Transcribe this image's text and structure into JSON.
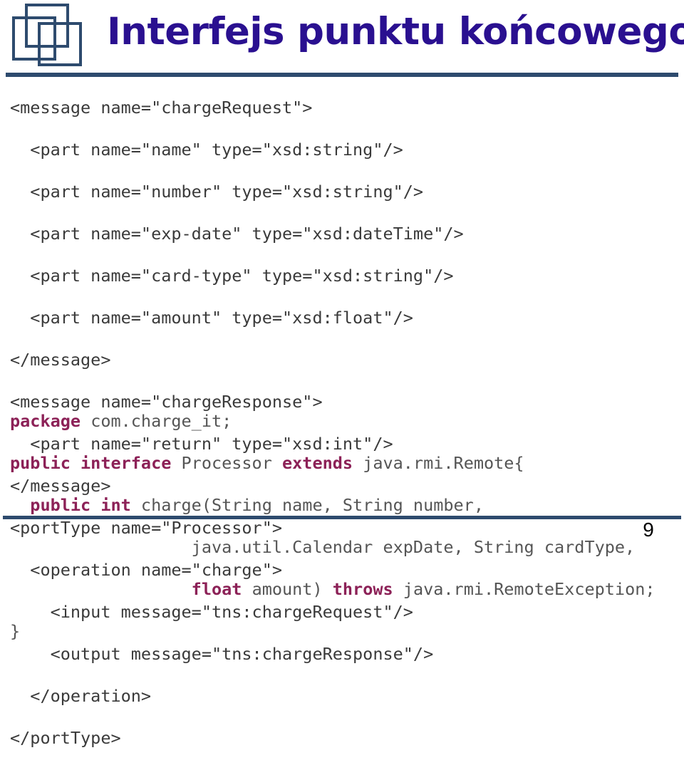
{
  "header": {
    "title": "Interfejs punktu końcowego",
    "logo_icon": "three-overlapping-squares-logo",
    "title_color": "#2a1090",
    "rule_color": "#2e4b6e"
  },
  "wsdl_code": {
    "language": "xml",
    "lines": [
      "<message name=\"chargeRequest\">",
      "  <part name=\"name\" type=\"xsd:string\"/>",
      "  <part name=\"number\" type=\"xsd:string\"/>",
      "  <part name=\"exp-date\" type=\"xsd:dateTime\"/>",
      "  <part name=\"card-type\" type=\"xsd:string\"/>",
      "  <part name=\"amount\" type=\"xsd:float\"/>",
      "</message>",
      "<message name=\"chargeResponse\">",
      "  <part name=\"return\" type=\"xsd:int\"/>",
      "</message>",
      "<portType name=\"Processor\">",
      "  <operation name=\"charge\">",
      "    <input message=\"tns:chargeRequest\"/>",
      "    <output message=\"tns:chargeResponse\"/>",
      "  </operation>",
      "</portType>"
    ]
  },
  "java_code": {
    "language": "java",
    "keyword_color": "#8c2157",
    "lines": [
      [
        {
          "t": "package",
          "kw": true
        },
        {
          "t": " com.charge_it;",
          "kw": false
        }
      ],
      [
        {
          "t": "public interface",
          "kw": true
        },
        {
          "t": " Processor ",
          "kw": false
        },
        {
          "t": "extends",
          "kw": true
        },
        {
          "t": " java.rmi.Remote{",
          "kw": false
        }
      ],
      [
        {
          "t": "  ",
          "kw": false
        },
        {
          "t": "public int",
          "kw": true
        },
        {
          "t": " charge(String name, String number,",
          "kw": false
        }
      ],
      [
        {
          "t": "                  java.util.Calendar expDate, String cardType,",
          "kw": false
        }
      ],
      [
        {
          "t": "                  ",
          "kw": false
        },
        {
          "t": "float",
          "kw": true
        },
        {
          "t": " amount) ",
          "kw": false
        },
        {
          "t": "throws",
          "kw": true
        },
        {
          "t": " java.rmi.RemoteException;",
          "kw": false
        }
      ],
      [
        {
          "t": "}",
          "kw": false
        }
      ]
    ]
  },
  "footer": {
    "page_number": "9"
  }
}
